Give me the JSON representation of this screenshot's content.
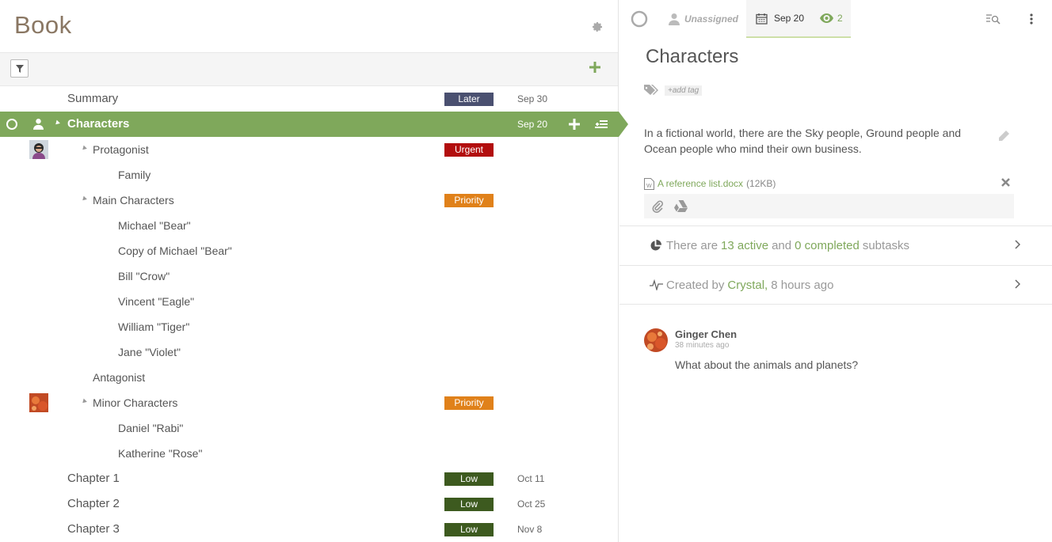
{
  "project": {
    "title": "Book"
  },
  "rows": [
    {
      "label": "Summary",
      "level": 0,
      "badge": "Later",
      "badge_color": "#4a5070",
      "date": "Sep 30"
    },
    {
      "label": "Characters",
      "level": 0,
      "selected": true,
      "date": "Sep 20"
    },
    {
      "label": "Protagonist",
      "level": 1,
      "expand": true,
      "badge": "Urgent",
      "badge_color": "#b20e0e",
      "avatar": "woman"
    },
    {
      "label": "Family",
      "level": 2
    },
    {
      "label": "Main Characters",
      "level": 1,
      "expand": true,
      "badge": "Priority",
      "badge_color": "#e0811a"
    },
    {
      "label": "Michael \"Bear\"",
      "level": 2
    },
    {
      "label": "Copy of Michael \"Bear\"",
      "level": 2
    },
    {
      "label": "Bill \"Crow\"",
      "level": 2
    },
    {
      "label": "Vincent \"Eagle\"",
      "level": 2
    },
    {
      "label": "William \"Tiger\"",
      "level": 2
    },
    {
      "label": "Jane \"Violet\"",
      "level": 2
    },
    {
      "label": "Antagonist",
      "level": 1
    },
    {
      "label": "Minor Characters",
      "level": 1,
      "expand": true,
      "badge": "Priority",
      "badge_color": "#e0811a",
      "avatar": "flower"
    },
    {
      "label": "Daniel \"Rabi\"",
      "level": 2
    },
    {
      "label": "Katherine \"Rose\"",
      "level": 2
    },
    {
      "label": "Chapter 1",
      "level": 0,
      "badge": "Low",
      "badge_color": "#3d5a1f",
      "date": "Oct 11"
    },
    {
      "label": "Chapter 2",
      "level": 0,
      "badge": "Low",
      "badge_color": "#3d5a1f",
      "date": "Oct 25"
    },
    {
      "label": "Chapter 3",
      "level": 0,
      "badge": "Low",
      "badge_color": "#3d5a1f",
      "date": "Nov 8"
    }
  ],
  "detail": {
    "assignee": "Unassigned",
    "date": "Sep 20",
    "watchers": "2",
    "title": "Characters",
    "add_tag": "+add tag",
    "description": "In a fictional world, there are the Sky people, Ground people and Ocean people who mind their own business.",
    "attachment": {
      "name": "A reference list.docx",
      "size": "(12KB)"
    },
    "subtasks": {
      "prefix": "There are",
      "active": "13 active",
      "mid": "and",
      "completed": "0 completed",
      "suffix": "subtasks"
    },
    "created": {
      "prefix": "Created by",
      "author": "Crystal,",
      "time": "8 hours ago"
    },
    "comment": {
      "author": "Ginger Chen",
      "time": "38 minutes ago",
      "text": "What about the animals and planets?"
    }
  },
  "colors": {
    "accent": "#7fa85b",
    "title": "#8a7763"
  }
}
